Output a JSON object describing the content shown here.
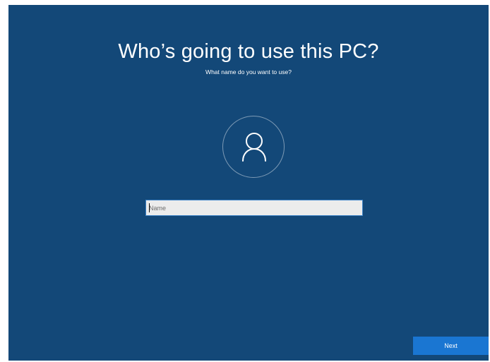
{
  "page": {
    "title": "Who’s going to use this PC?",
    "subtitle": "What name do you want to use?"
  },
  "avatar": {
    "icon": "user-icon"
  },
  "name_field": {
    "placeholder": "Name",
    "value": ""
  },
  "footer": {
    "next_label": "Next"
  },
  "colors": {
    "background": "#134878",
    "accent": "#1a76d2",
    "input_background": "#ececec",
    "input_border": "#3d83c7"
  }
}
